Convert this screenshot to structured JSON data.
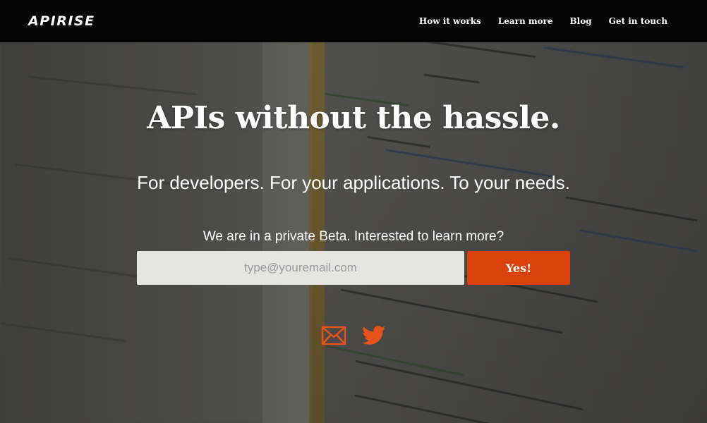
{
  "brand": {
    "logo_text": "APIRISE"
  },
  "nav": {
    "items": [
      {
        "label": "How it works"
      },
      {
        "label": "Learn more"
      },
      {
        "label": "Blog"
      },
      {
        "label": "Get in touch"
      }
    ]
  },
  "hero": {
    "headline": "APIs without the hassle.",
    "tagline": "For developers. For your applications. To your needs.",
    "beta_text": "We are in a private Beta. Interested to learn more?",
    "email_placeholder": "type@youremail.com",
    "email_value": "",
    "submit_label": "Yes!"
  },
  "social": {
    "icons": [
      "mail-icon",
      "twitter-icon"
    ]
  },
  "colors": {
    "accent": "#d9430b",
    "navbar_bg": "#040404",
    "input_bg": "#e5e6e3"
  }
}
